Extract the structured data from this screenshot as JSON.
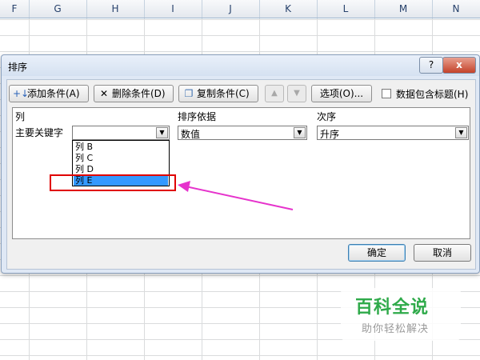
{
  "spreadsheet": {
    "columns": [
      "F",
      "G",
      "H",
      "I",
      "J",
      "K",
      "L",
      "M",
      "N"
    ]
  },
  "dialog": {
    "title": "排序",
    "help_label": "?",
    "close_label": "x",
    "toolbar": {
      "add_label": "添加条件(A)",
      "delete_label": "删除条件(D)",
      "copy_label": "复制条件(C)",
      "options_label": "选项(O)...",
      "header_checkbox_label": "数据包含标题(H)",
      "header_checkbox_checked": false
    },
    "table": {
      "headers": {
        "column": "列",
        "sort_on": "排序依据",
        "order": "次序"
      },
      "row_label": "主要关键字",
      "key_value": "",
      "sort_on_value": "数值",
      "order_value": "升序",
      "dropdown_options": [
        "列 B",
        "列 C",
        "列 D",
        "列 E"
      ],
      "selected_option": "列 E"
    },
    "ok_label": "确定",
    "cancel_label": "取消"
  },
  "watermark": {
    "logo_text": "百科全说",
    "tagline": "助你轻松解决"
  },
  "colors": {
    "selection": "#3399ff",
    "highlight_box": "#e00000",
    "annotation_arrow": "#e633cc",
    "watermark_green": "#2faa4a"
  }
}
